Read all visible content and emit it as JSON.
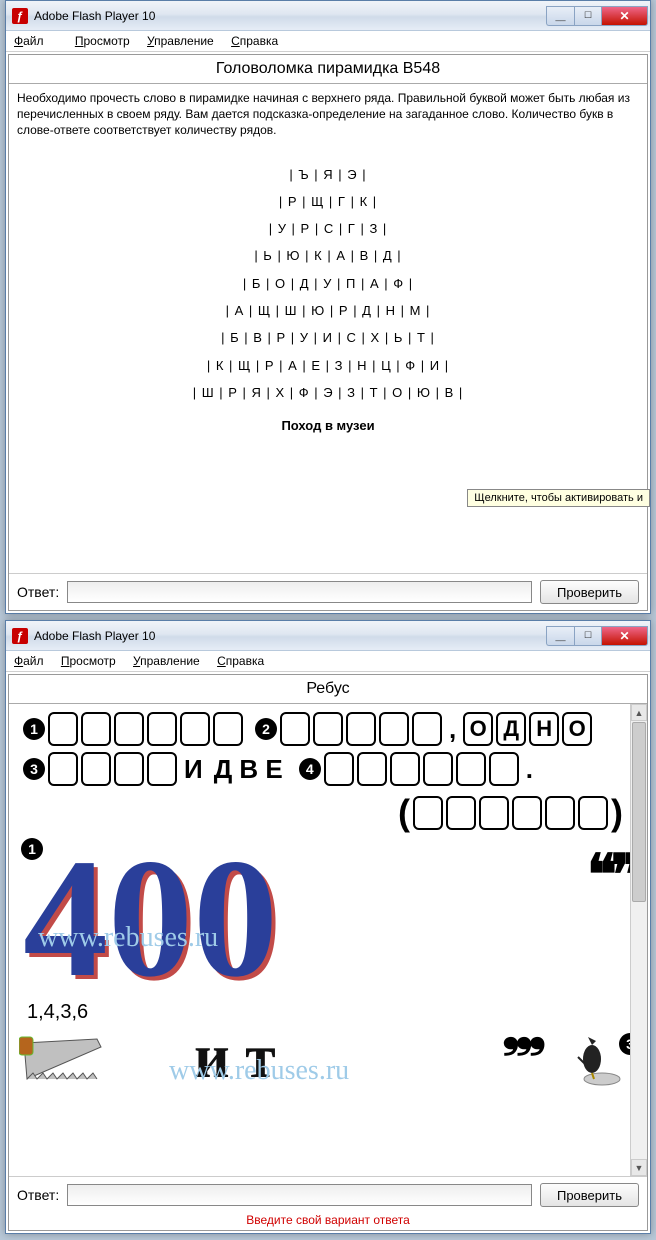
{
  "window1": {
    "title": "Adobe Flash Player 10",
    "menu": {
      "file": "Файл",
      "view": "Просмотр",
      "control": "Управление",
      "help": "Справка"
    },
    "page_title": "Головоломка пирамидка B548",
    "instructions": "Необходимо прочесть слово в пирамидке начиная с верхнего ряда. Правильной буквой может быть любая из перечисленных в своем ряду. Вам дается подсказка-определение на загаданное слово. Количество букв в слове-ответе соответствует количеству рядов.",
    "pyramid_rows": [
      "| Ъ | Я | Э |",
      "| Р | Щ | Г | К |",
      "| У | Р | С | Г | З |",
      "| Ь | Ю | К | А | В | Д |",
      "| Б | О | Д | У | П | А | Ф |",
      "| А | Щ | Ш | Ю | Р | Д | Н | М |",
      "| Б | В | Р | У | И | С | Х | Ь | Т |",
      "| К | Щ | Р | А | Е | З | Н | Ц | Ф | И |",
      "| Ш | Р | Я | Х | Ф | Э | З | Т | О | Ю | В |"
    ],
    "hint": "Поход в музеи",
    "answer_label": "Ответ:",
    "check_button": "Проверить",
    "tooltip": "Щелкните, чтобы активировать и"
  },
  "window2": {
    "title": "Adobe Flash Player 10",
    "menu": {
      "file": "Файл",
      "view": "Просмотр",
      "control": "Управление",
      "help": "Справка"
    },
    "page_title": "Ребус",
    "words": {
      "odno": "О Д Н О",
      "i": "И",
      "dve": "Д В Е"
    },
    "big_number": "400",
    "sequence": "1,4,3,6",
    "watermark": "www.rebuses.ru",
    "answer_label": "Ответ:",
    "check_button": "Проверить",
    "error": "Введите свой вариант ответа"
  }
}
